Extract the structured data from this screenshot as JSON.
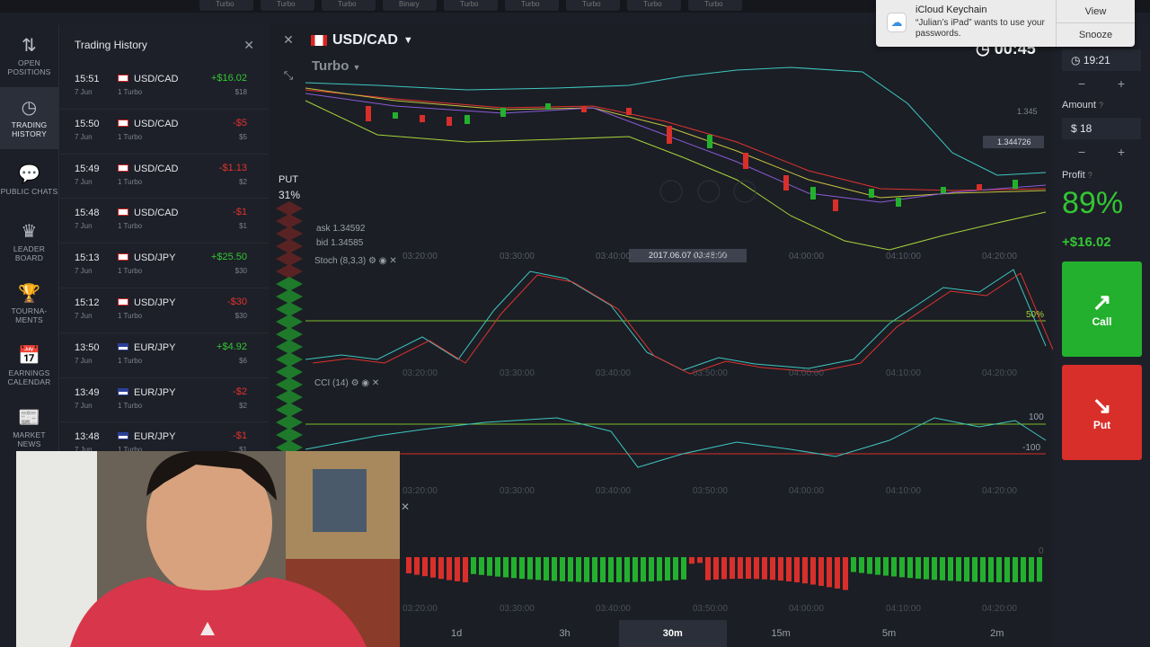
{
  "topbar": {
    "tabs": [
      "Turbo",
      "Turbo",
      "Turbo",
      "Binary",
      "Turbo",
      "Turbo",
      "Turbo",
      "Turbo",
      "Turbo"
    ]
  },
  "nav": [
    {
      "icon": "arrows-updown-icon",
      "glyph": "⇅",
      "label": "OPEN POSITIONS"
    },
    {
      "icon": "history-icon",
      "glyph": "◷",
      "label": "TRADING HISTORY"
    },
    {
      "icon": "chat-icon",
      "glyph": "💬",
      "label": "PUBLIC CHATS"
    },
    {
      "icon": "leader-icon",
      "glyph": "♛",
      "label": "LEADER BOARD"
    },
    {
      "icon": "trophy-icon",
      "glyph": "🏆",
      "label": "TOURNA-MENTS"
    },
    {
      "icon": "calendar-icon",
      "glyph": "📅",
      "label": "EARNINGS CALENDAR"
    },
    {
      "icon": "news-icon",
      "glyph": "📰",
      "label": "MARKET NEWS"
    }
  ],
  "history": {
    "title": "Trading History",
    "rows": [
      {
        "time": "15:51",
        "date": "7 Jun",
        "pair": "USD/CAD",
        "kind": "1 Turbo",
        "pnl": "+$16.02",
        "amt": "$18",
        "win": true,
        "flag": "ca"
      },
      {
        "time": "15:50",
        "date": "7 Jun",
        "pair": "USD/CAD",
        "kind": "1 Turbo",
        "pnl": "-$5",
        "amt": "$5",
        "win": false,
        "flag": "ca"
      },
      {
        "time": "15:49",
        "date": "7 Jun",
        "pair": "USD/CAD",
        "kind": "1 Turbo",
        "pnl": "-$1.13",
        "amt": "$2",
        "win": false,
        "flag": "ca"
      },
      {
        "time": "15:48",
        "date": "7 Jun",
        "pair": "USD/CAD",
        "kind": "1 Turbo",
        "pnl": "-$1",
        "amt": "$1",
        "win": false,
        "flag": "ca"
      },
      {
        "time": "15:13",
        "date": "7 Jun",
        "pair": "USD/JPY",
        "kind": "1 Turbo",
        "pnl": "+$25.50",
        "amt": "$30",
        "win": true,
        "flag": "jp"
      },
      {
        "time": "15:12",
        "date": "7 Jun",
        "pair": "USD/JPY",
        "kind": "1 Turbo",
        "pnl": "-$30",
        "amt": "$30",
        "win": false,
        "flag": "jp"
      },
      {
        "time": "13:50",
        "date": "7 Jun",
        "pair": "EUR/JPY",
        "kind": "1 Turbo",
        "pnl": "+$4.92",
        "amt": "$6",
        "win": true,
        "flag": "eu"
      },
      {
        "time": "13:49",
        "date": "7 Jun",
        "pair": "EUR/JPY",
        "kind": "1 Turbo",
        "pnl": "-$2",
        "amt": "$2",
        "win": false,
        "flag": "eu"
      },
      {
        "time": "13:48",
        "date": "7 Jun",
        "pair": "EUR/JPY",
        "kind": "1 Turbo",
        "pnl": "-$1",
        "amt": "$1",
        "win": false,
        "flag": "eu"
      }
    ]
  },
  "chart": {
    "pair": "USD/CAD",
    "mode": "Turbo",
    "timer": "00:45",
    "put_label": "PUT",
    "put_pct": "31%",
    "ask": "ask 1.34592",
    "bid": "bid 1.34585",
    "price_label": "1.345",
    "price_tag": "1.344726",
    "date_tag": "2017.06.07 03:48:00",
    "stoch_label": "Stoch (8,3,3)",
    "cci_label": "CCI (14)",
    "stoch_level": "50%",
    "cci_high": "100",
    "cci_low": "-100",
    "macd_zero": "0",
    "xticks": [
      "03:20:00",
      "03:30:00",
      "03:40:00",
      "03:50:00",
      "04:00:00",
      "04:10:00",
      "04:20:00"
    ],
    "timeframes": [
      "1d",
      "3h",
      "30m",
      "15m",
      "5m",
      "2m"
    ],
    "active_tf": "30m"
  },
  "right": {
    "time": "19:21",
    "amount_label": "Amount",
    "amount": "$ 18",
    "profit_label": "Profit",
    "profit_pct": "89%",
    "profit_value": "+$16.02",
    "call_label": "Call",
    "put_label": "Put"
  },
  "notification": {
    "title": "iCloud Keychain",
    "message": "“Julian’s iPad” wants to use your passwords.",
    "view": "View",
    "snooze": "Snooze"
  },
  "colors": {
    "green": "#33c533",
    "red": "#e0322f",
    "call": "#24b02f",
    "put": "#d92f2a"
  }
}
